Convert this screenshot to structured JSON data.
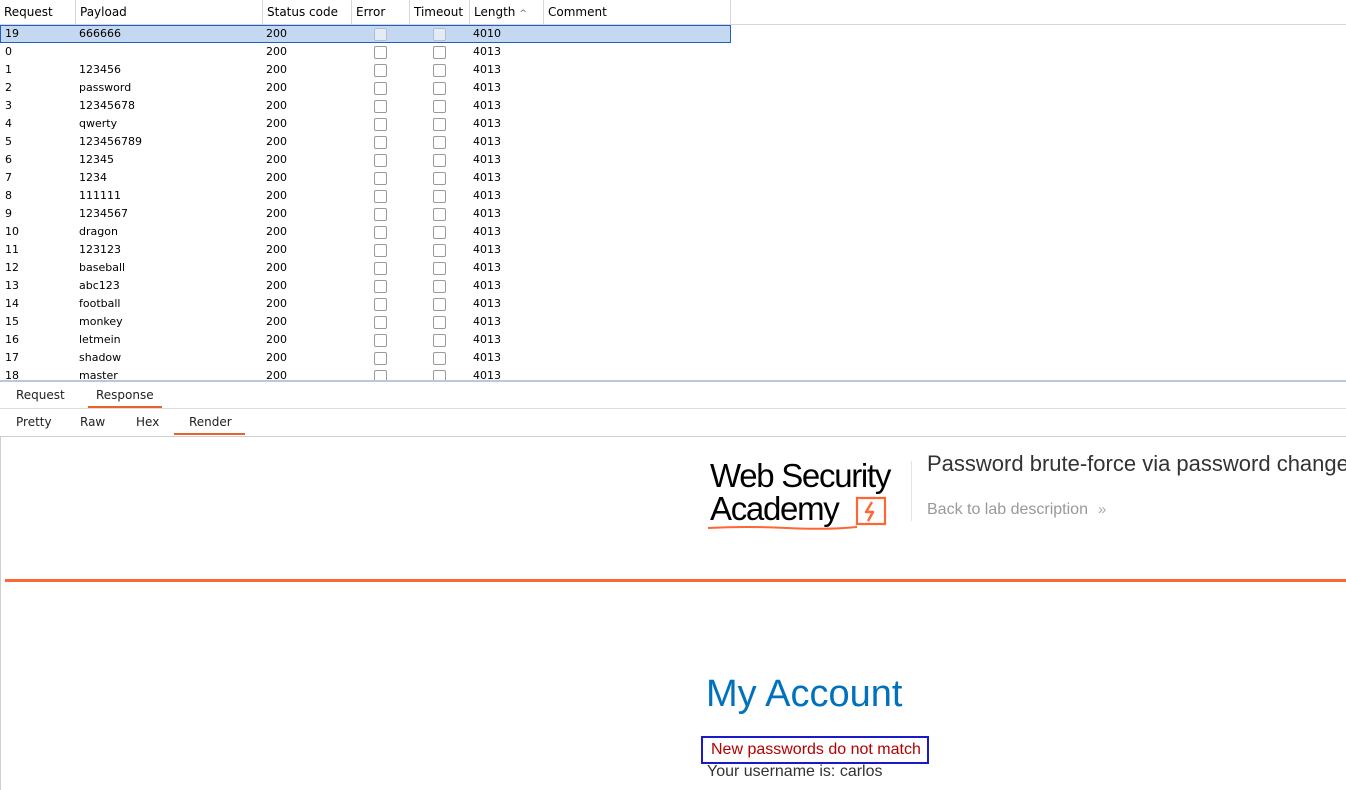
{
  "table": {
    "columns": [
      "Request",
      "Payload",
      "Status code",
      "Error",
      "Timeout",
      "Length",
      "Comment"
    ],
    "sort_indicator": "^",
    "rows": [
      {
        "request": "19",
        "payload": "666666",
        "status": "200",
        "error": false,
        "timeout": false,
        "length": "4010",
        "comment": "",
        "selected": true
      },
      {
        "request": "0",
        "payload": "",
        "status": "200",
        "error": false,
        "timeout": false,
        "length": "4013",
        "comment": ""
      },
      {
        "request": "1",
        "payload": "123456",
        "status": "200",
        "error": false,
        "timeout": false,
        "length": "4013",
        "comment": ""
      },
      {
        "request": "2",
        "payload": "password",
        "status": "200",
        "error": false,
        "timeout": false,
        "length": "4013",
        "comment": ""
      },
      {
        "request": "3",
        "payload": "12345678",
        "status": "200",
        "error": false,
        "timeout": false,
        "length": "4013",
        "comment": ""
      },
      {
        "request": "4",
        "payload": "qwerty",
        "status": "200",
        "error": false,
        "timeout": false,
        "length": "4013",
        "comment": ""
      },
      {
        "request": "5",
        "payload": "123456789",
        "status": "200",
        "error": false,
        "timeout": false,
        "length": "4013",
        "comment": ""
      },
      {
        "request": "6",
        "payload": "12345",
        "status": "200",
        "error": false,
        "timeout": false,
        "length": "4013",
        "comment": ""
      },
      {
        "request": "7",
        "payload": "1234",
        "status": "200",
        "error": false,
        "timeout": false,
        "length": "4013",
        "comment": ""
      },
      {
        "request": "8",
        "payload": "111111",
        "status": "200",
        "error": false,
        "timeout": false,
        "length": "4013",
        "comment": ""
      },
      {
        "request": "9",
        "payload": "1234567",
        "status": "200",
        "error": false,
        "timeout": false,
        "length": "4013",
        "comment": ""
      },
      {
        "request": "10",
        "payload": "dragon",
        "status": "200",
        "error": false,
        "timeout": false,
        "length": "4013",
        "comment": ""
      },
      {
        "request": "11",
        "payload": "123123",
        "status": "200",
        "error": false,
        "timeout": false,
        "length": "4013",
        "comment": ""
      },
      {
        "request": "12",
        "payload": "baseball",
        "status": "200",
        "error": false,
        "timeout": false,
        "length": "4013",
        "comment": ""
      },
      {
        "request": "13",
        "payload": "abc123",
        "status": "200",
        "error": false,
        "timeout": false,
        "length": "4013",
        "comment": ""
      },
      {
        "request": "14",
        "payload": "football",
        "status": "200",
        "error": false,
        "timeout": false,
        "length": "4013",
        "comment": ""
      },
      {
        "request": "15",
        "payload": "monkey",
        "status": "200",
        "error": false,
        "timeout": false,
        "length": "4013",
        "comment": ""
      },
      {
        "request": "16",
        "payload": "letmein",
        "status": "200",
        "error": false,
        "timeout": false,
        "length": "4013",
        "comment": ""
      },
      {
        "request": "17",
        "payload": "shadow",
        "status": "200",
        "error": false,
        "timeout": false,
        "length": "4013",
        "comment": ""
      },
      {
        "request": "18",
        "payload": "master",
        "status": "200",
        "error": false,
        "timeout": false,
        "length": "4013",
        "comment": ""
      }
    ]
  },
  "message_tabs": {
    "request": "Request",
    "response": "Response",
    "active": "Response"
  },
  "view_tabs": {
    "pretty": "Pretty",
    "raw": "Raw",
    "hex": "Hex",
    "render": "Render",
    "active": "Render"
  },
  "render": {
    "logo_line1": "Web Security",
    "logo_line2": "Academy",
    "lab_title": "Password brute-force via password change",
    "back_link": "Back to lab description",
    "back_chevron": "»",
    "page_title": "My Account",
    "error_message": "New passwords do not match",
    "username_line": "Your username is: carlos"
  },
  "colors": {
    "accent_orange": "#ff6633",
    "selection": "#c5d8f1",
    "title_blue": "#0071bc",
    "error_red": "#b50000"
  }
}
